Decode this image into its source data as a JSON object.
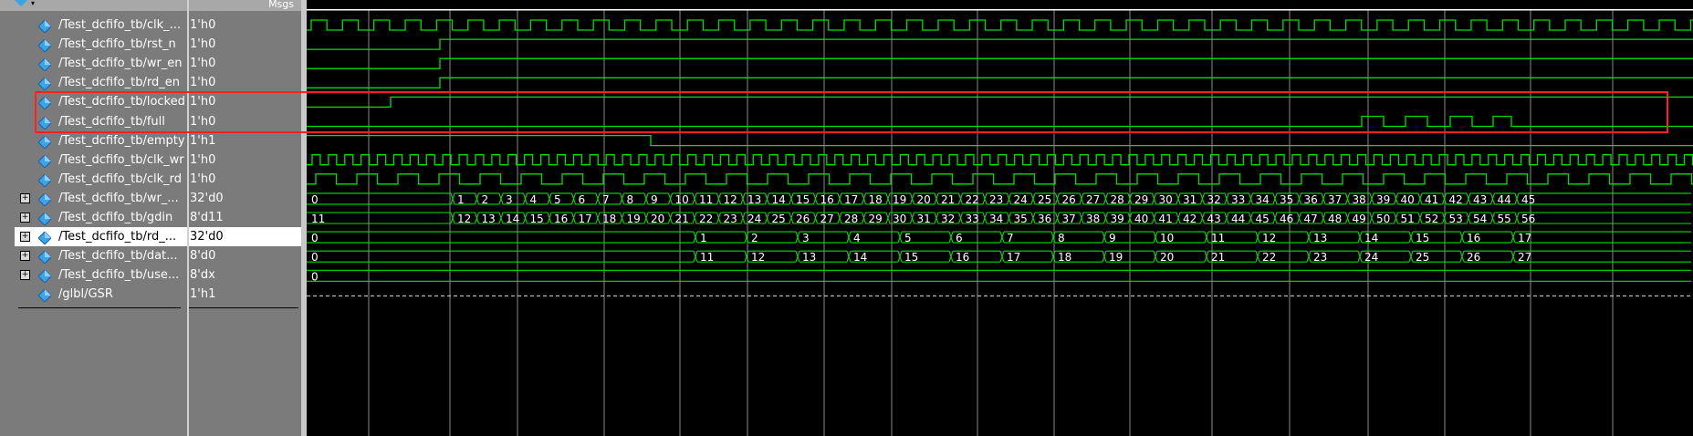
{
  "header": {
    "msgs_label": "Msgs"
  },
  "signals": [
    {
      "name": "/Test_dcfifo_tb/clk_...",
      "value": "1'h0",
      "group": false
    },
    {
      "name": "/Test_dcfifo_tb/rst_n",
      "value": "1'h0",
      "group": false
    },
    {
      "name": "/Test_dcfifo_tb/wr_en",
      "value": "1'h0",
      "group": false
    },
    {
      "name": "/Test_dcfifo_tb/rd_en",
      "value": "1'h0",
      "group": false
    },
    {
      "name": "/Test_dcfifo_tb/locked",
      "value": "1'h0",
      "group": false
    },
    {
      "name": "/Test_dcfifo_tb/full",
      "value": "1'h0",
      "group": false
    },
    {
      "name": "/Test_dcfifo_tb/empty",
      "value": "1'h1",
      "group": false
    },
    {
      "name": "/Test_dcfifo_tb/clk_wr",
      "value": "1'h0",
      "group": false
    },
    {
      "name": "/Test_dcfifo_tb/clk_rd",
      "value": "1'h0",
      "group": false
    },
    {
      "name": "/Test_dcfifo_tb/wr_...",
      "value": "32'd0",
      "group": true
    },
    {
      "name": "/Test_dcfifo_tb/gdin",
      "value": "8'd11",
      "group": true
    },
    {
      "name": "/Test_dcfifo_tb/rd_...",
      "value": "32'd0",
      "group": true,
      "selected": true
    },
    {
      "name": "/Test_dcfifo_tb/dat...",
      "value": "8'd0",
      "group": true
    },
    {
      "name": "/Test_dcfifo_tb/use...",
      "value": "8'dx",
      "group": true
    },
    {
      "name": "/glbl/GSR",
      "value": "1'h1",
      "group": false
    }
  ],
  "bus_rows": [
    {
      "first": "0",
      "labels": [
        "1",
        "2",
        "3",
        "4",
        "5",
        "6",
        "7",
        "8",
        "9",
        "10",
        "11",
        "12",
        "13",
        "14",
        "15",
        "16",
        "17",
        "18",
        "19",
        "20",
        "21",
        "22",
        "23",
        "24",
        "25",
        "26",
        "27",
        "28",
        "29",
        "30",
        "31",
        "32",
        "33",
        "34",
        "35",
        "36",
        "37",
        "38",
        "39",
        "40",
        "41",
        "42",
        "43",
        "44",
        "45"
      ]
    },
    {
      "first": "11",
      "labels": [
        "12",
        "13",
        "14",
        "15",
        "16",
        "17",
        "18",
        "19",
        "20",
        "21",
        "22",
        "23",
        "24",
        "25",
        "26",
        "27",
        "28",
        "29",
        "30",
        "31",
        "32",
        "33",
        "34",
        "35",
        "36",
        "37",
        "38",
        "39",
        "40",
        "41",
        "42",
        "43",
        "44",
        "45",
        "46",
        "47",
        "48",
        "49",
        "50",
        "51",
        "52",
        "53",
        "54",
        "55",
        "56"
      ]
    },
    {
      "first": "0",
      "labels": [
        "1",
        "2",
        "3",
        "4",
        "5",
        "6",
        "7",
        "8",
        "9",
        "10",
        "11",
        "12",
        "13",
        "14",
        "15",
        "16",
        "17"
      ]
    },
    {
      "first": "0",
      "labels": [
        "11",
        "12",
        "13",
        "14",
        "15",
        "16",
        "17",
        "18",
        "19",
        "20",
        "21",
        "22",
        "23",
        "24",
        "25",
        "26",
        "27"
      ]
    },
    {
      "first": "0",
      "labels": []
    }
  ],
  "colors": {
    "wave": "#00e000",
    "grid": "#8a8a8a",
    "panel": "#7b7b7b",
    "highlight_box": "#ff2020",
    "diamond": "#3ba3e8"
  }
}
